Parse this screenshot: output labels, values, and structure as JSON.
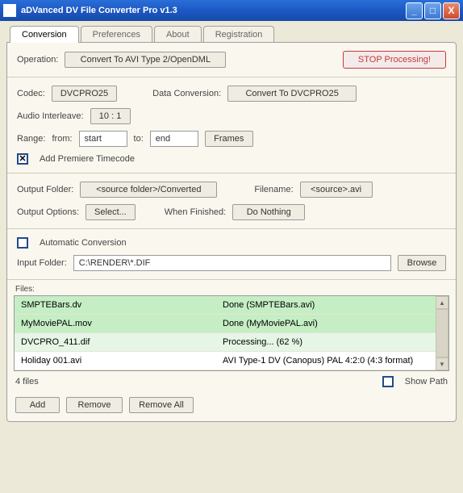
{
  "window": {
    "title": "aDVanced DV File Converter Pro v1.3"
  },
  "tabs": {
    "conversion": "Conversion",
    "preferences": "Preferences",
    "about": "About",
    "registration": "Registration"
  },
  "operation": {
    "label": "Operation:",
    "value": "Convert To AVI Type 2/OpenDML",
    "stop": "STOP Processing!"
  },
  "codec": {
    "label": "Codec:",
    "value": "DVCPRO25",
    "dataconv_label": "Data Conversion:",
    "dataconv_value": "Convert To DVCPRO25"
  },
  "audio": {
    "label": "Audio Interleave:",
    "value": "10 : 1"
  },
  "range": {
    "label": "Range:",
    "from_label": "from:",
    "from_value": "start",
    "to_label": "to:",
    "to_value": "end",
    "frames": "Frames"
  },
  "premiere": {
    "label": "Add Premiere Timecode"
  },
  "output": {
    "folder_label": "Output Folder:",
    "folder_value": "<source folder>/Converted",
    "filename_label": "Filename:",
    "filename_value": "<source>.avi",
    "options_label": "Output Options:",
    "select": "Select...",
    "when_finished_label": "When Finished:",
    "when_finished_value": "Do Nothing"
  },
  "input": {
    "auto_label": "Automatic Conversion",
    "folder_label": "Input Folder:",
    "folder_value": "C:\\RENDER\\*.DIF",
    "browse": "Browse"
  },
  "files": {
    "header": "Files:",
    "count": "4 files",
    "showpath": "Show Path",
    "items": [
      {
        "name": "SMPTEBars.dv",
        "status": "Done (SMPTEBars.avi)",
        "state": "done"
      },
      {
        "name": "MyMoviePAL.mov",
        "status": "Done (MyMoviePAL.avi)",
        "state": "done"
      },
      {
        "name": "DVCPRO_411.dif",
        "status": "Processing... (62 %)",
        "state": "proc"
      },
      {
        "name": "Holiday 001.avi",
        "status": "AVI Type-1 DV (Canopus) PAL 4:2:0 (4:3 format)",
        "state": ""
      }
    ]
  },
  "actions": {
    "add": "Add",
    "remove": "Remove",
    "removeall": "Remove All"
  }
}
